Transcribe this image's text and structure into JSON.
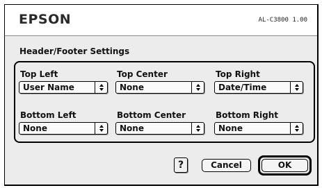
{
  "brand": {
    "logo": "EPSON",
    "model": "AL-C3800 1.00"
  },
  "section_title": "Header/Footer Settings",
  "fields": {
    "top_left": {
      "label": "Top Left",
      "value": "User Name"
    },
    "top_center": {
      "label": "Top Center",
      "value": "None"
    },
    "top_right": {
      "label": "Top Right",
      "value": "Date/Time"
    },
    "bottom_left": {
      "label": "Bottom Left",
      "value": "None"
    },
    "bottom_center": {
      "label": "Bottom Center",
      "value": "None"
    },
    "bottom_right": {
      "label": "Bottom Right",
      "value": "None"
    }
  },
  "buttons": {
    "help": "?",
    "cancel": "Cancel",
    "ok": "OK"
  },
  "icons": {
    "popup_arrows": "up-down-arrows-icon"
  }
}
